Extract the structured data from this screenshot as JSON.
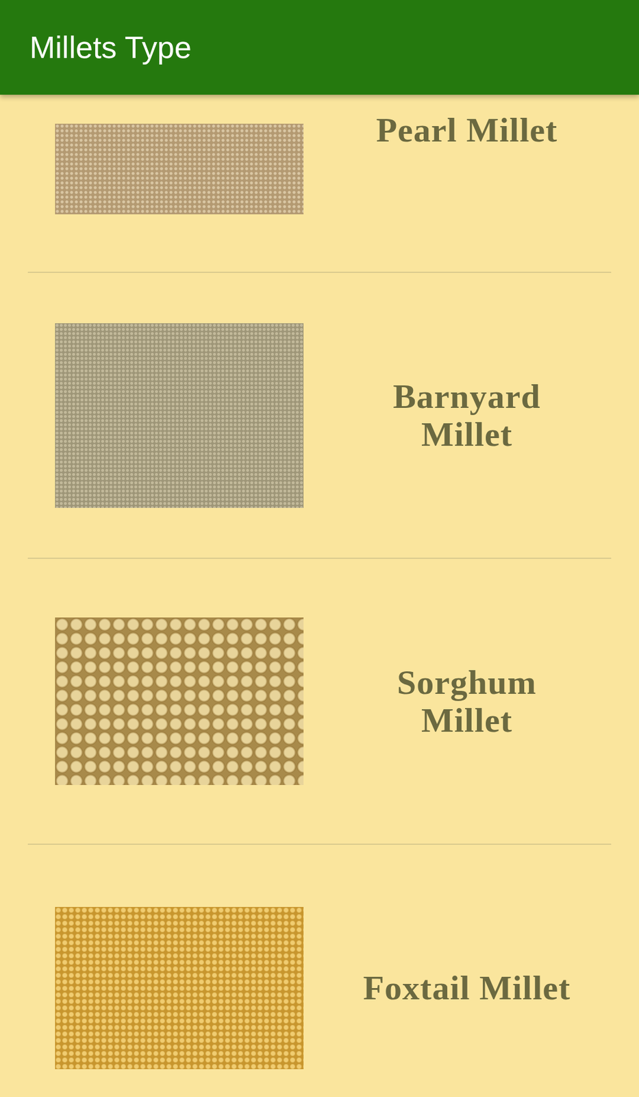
{
  "app_bar": {
    "title": "Millets Type"
  },
  "millets": [
    {
      "name": "Pearl Millet"
    },
    {
      "name": "Barnyard Millet"
    },
    {
      "name": "Sorghum Millet"
    },
    {
      "name": "Foxtail Millet"
    }
  ]
}
